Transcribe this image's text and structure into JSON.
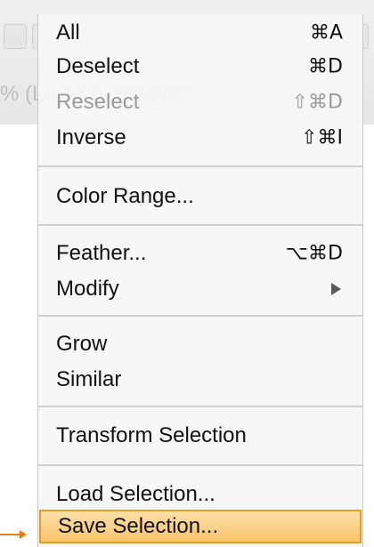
{
  "menu": {
    "items": [
      {
        "label": "All",
        "shortcut": "⌘A",
        "enabled": true
      },
      {
        "label": "Deselect",
        "shortcut": "⌘D",
        "enabled": true
      },
      {
        "label": "Reselect",
        "shortcut": "⇧⌘D",
        "enabled": false
      },
      {
        "label": "Inverse",
        "shortcut": "⇧⌘I",
        "enabled": true
      },
      {
        "label": "Color Range...",
        "shortcut": "",
        "enabled": true
      },
      {
        "label": "Feather...",
        "shortcut": "⌥⌘D",
        "enabled": true
      },
      {
        "label": "Modify",
        "shortcut": "",
        "enabled": true,
        "submenu_icon": "triangle-right-icon"
      },
      {
        "label": "Grow",
        "shortcut": "",
        "enabled": true
      },
      {
        "label": "Similar",
        "shortcut": "",
        "enabled": true
      },
      {
        "label": "Transform Selection",
        "shortcut": "",
        "enabled": true
      },
      {
        "label": "Load Selection...",
        "shortcut": "",
        "enabled": true
      },
      {
        "label": "Save Selection...",
        "shortcut": "",
        "enabled": true,
        "highlighted": true
      }
    ]
  },
  "background": {
    "faded_title": "% (Layer 0, RGB/8*)"
  },
  "colors": {
    "highlight_fill": "#f8c46a",
    "highlight_border": "#e89a22",
    "disabled_text": "#9a9a9a",
    "pointer_arrow": "#e0801a"
  },
  "icons": {
    "submenu": "triangle-right-icon",
    "pointer": "arrow-pointer-icon"
  }
}
